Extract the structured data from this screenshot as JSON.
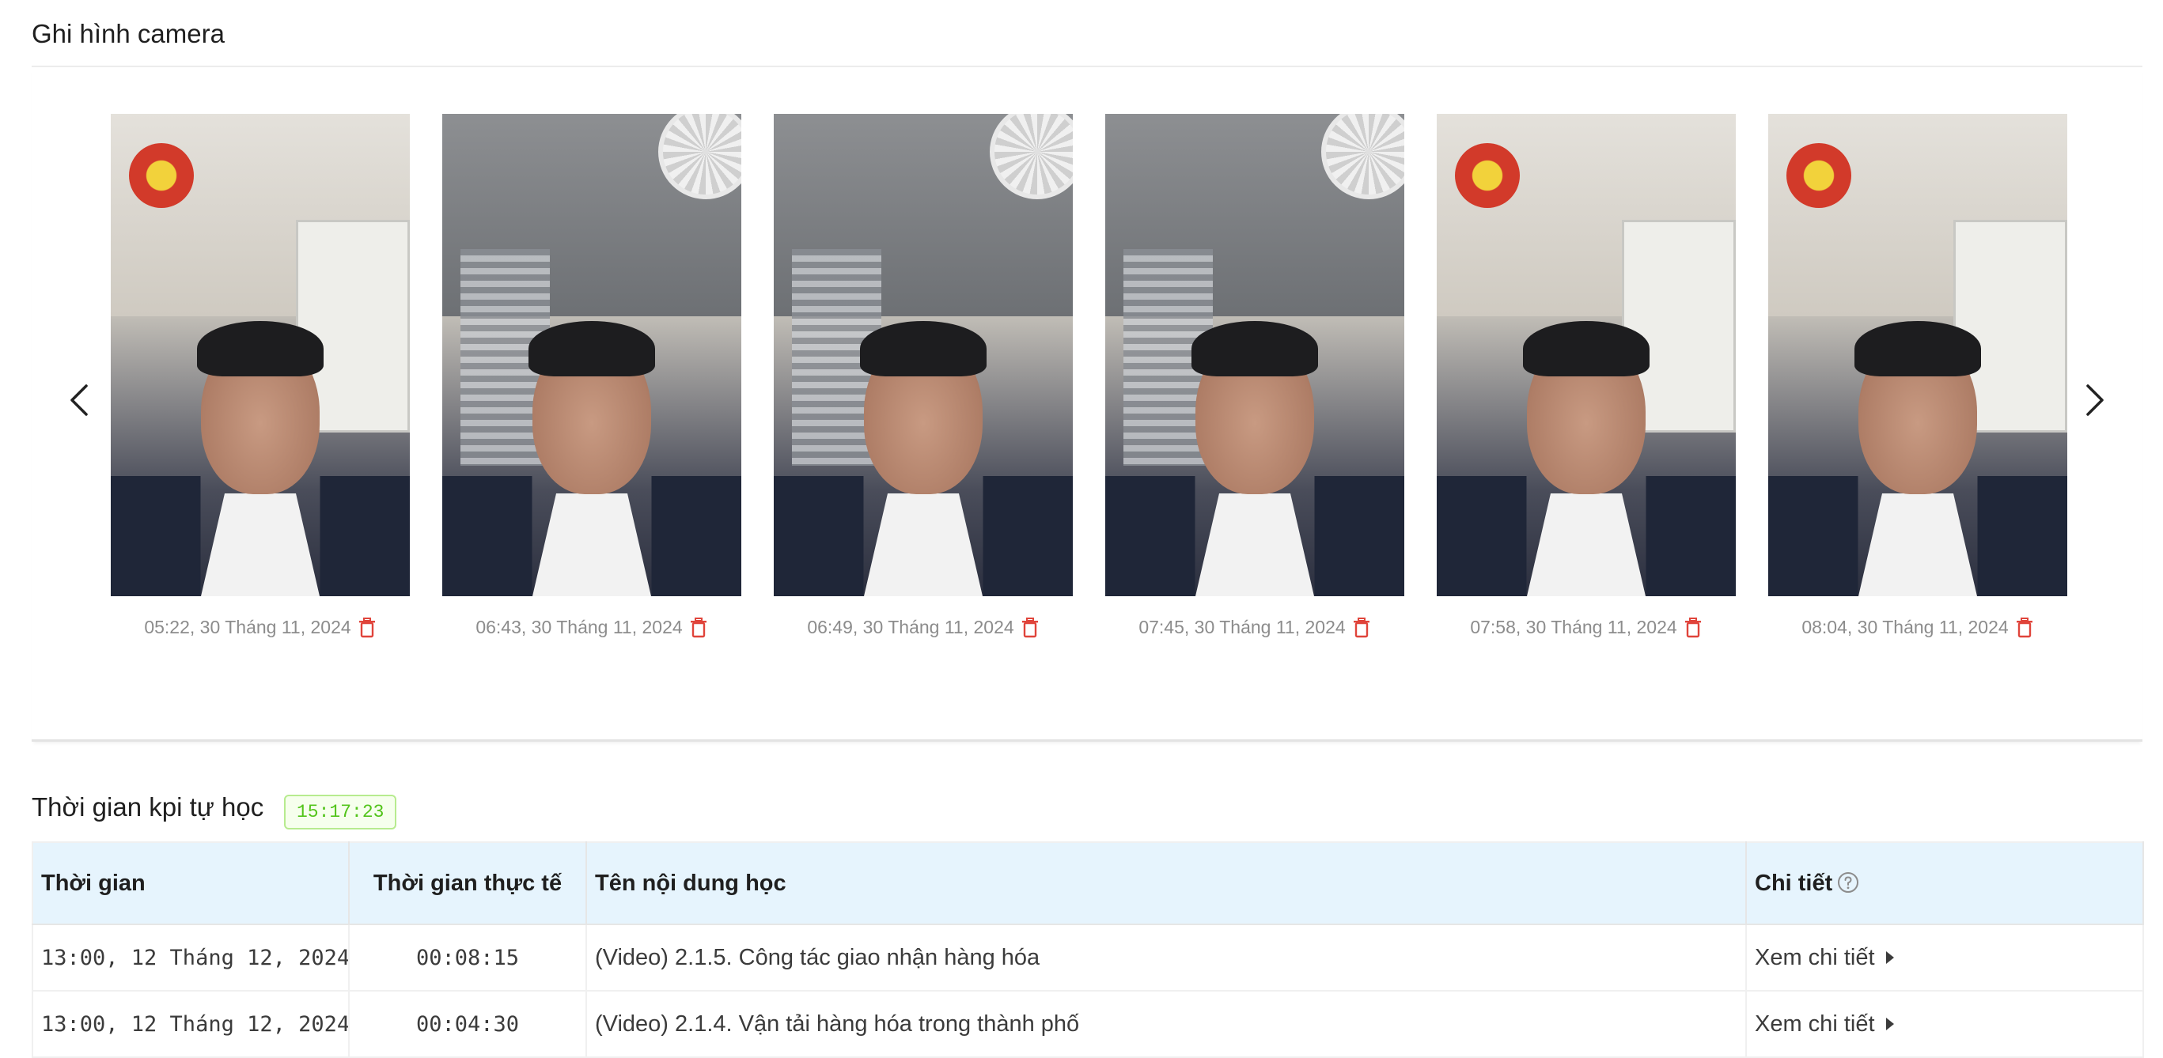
{
  "camera": {
    "title": "Ghi hình camera",
    "icons": {
      "prev": "chevron-left-icon",
      "next": "chevron-right-icon",
      "delete": "trash-icon"
    },
    "captures": [
      {
        "time": "05:22, 30 Tháng 11, 2024",
        "scene": "alarm-board"
      },
      {
        "time": "06:43, 30 Tháng 11, 2024",
        "scene": "window-fan"
      },
      {
        "time": "06:49, 30 Tháng 11, 2024",
        "scene": "window-fan"
      },
      {
        "time": "07:45, 30 Tháng 11, 2024",
        "scene": "window-fan"
      },
      {
        "time": "07:58, 30 Tháng 11, 2024",
        "scene": "alarm-board"
      },
      {
        "time": "08:04, 30 Tháng 11, 2024",
        "scene": "alarm-board"
      }
    ]
  },
  "kpi": {
    "title": "Thời gian kpi tự học",
    "total": "15:17:23",
    "columns": {
      "time": "Thời gian",
      "actual": "Thời gian thực tế",
      "content": "Tên nội dung học",
      "detail": "Chi tiết"
    },
    "rows": [
      {
        "time": "13:00, 12 Tháng 12, 2024",
        "actual": "00:08:15",
        "content": "(Video) 2.1.5. Công tác giao nhận hàng hóa",
        "detail": "Xem chi tiết"
      },
      {
        "time": "13:00, 12 Tháng 12, 2024",
        "actual": "00:04:30",
        "content": "(Video) 2.1.4. Vận tải hàng hóa trong thành phố",
        "detail": "Xem chi tiết"
      }
    ]
  },
  "colors": {
    "delete": "#e0443b",
    "badge_text": "#52c41a",
    "header_bg": "#e6f4fd"
  }
}
